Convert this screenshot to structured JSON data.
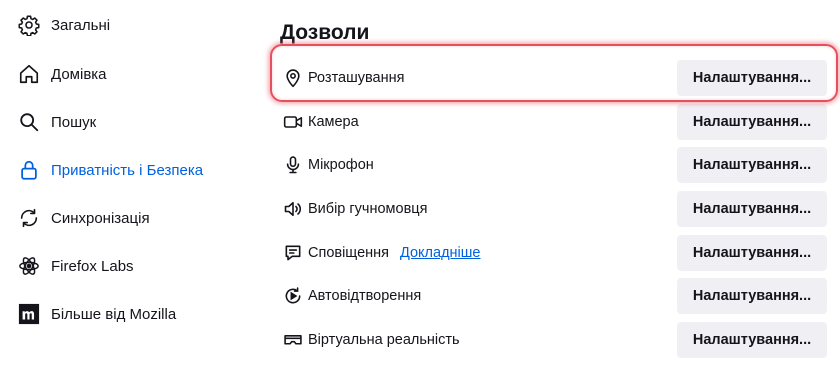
{
  "sidebar": {
    "items": [
      {
        "label": "Загальні",
        "icon": "gear-icon"
      },
      {
        "label": "Домівка",
        "icon": "home-icon"
      },
      {
        "label": "Пошук",
        "icon": "search-icon"
      },
      {
        "label": "Приватність і Безпека",
        "icon": "lock-icon",
        "active": true
      },
      {
        "label": "Синхронізація",
        "icon": "sync-icon"
      },
      {
        "label": "Firefox Labs",
        "icon": "labs-icon"
      },
      {
        "label": "Більше від Mozilla",
        "icon": "mozilla-icon"
      }
    ]
  },
  "main": {
    "section_title": "Дозволи",
    "permissions": [
      {
        "label": "Розташування",
        "icon": "location-pin-icon",
        "button_label": "Налаштування..."
      },
      {
        "label": "Камера",
        "icon": "camera-icon",
        "button_label": "Налаштування..."
      },
      {
        "label": "Мікрофон",
        "icon": "microphone-icon",
        "button_label": "Налаштування..."
      },
      {
        "label": "Вибір гучномовця",
        "icon": "speaker-icon",
        "button_label": "Налаштування..."
      },
      {
        "label": "Сповіщення",
        "icon": "notification-icon",
        "link": "Докладніше",
        "button_label": "Налаштування..."
      },
      {
        "label": "Автовідтворення",
        "icon": "autoplay-icon",
        "button_label": "Налаштування..."
      },
      {
        "label": "Віртуальна реальність",
        "icon": "vr-headset-icon",
        "button_label": "Налаштування..."
      }
    ]
  },
  "colors": {
    "accent": "#0061e0",
    "highlight": "#e5505f",
    "button_bg": "#f0f0f4",
    "text": "#15141a"
  }
}
